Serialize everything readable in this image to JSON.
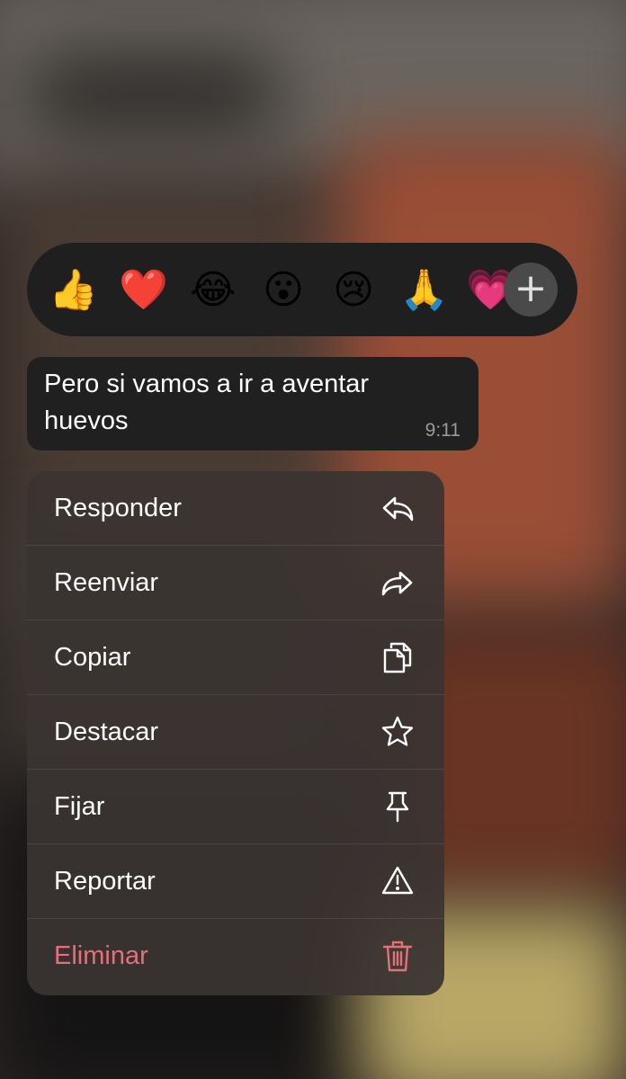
{
  "colors": {
    "menu_text": "#ffffff",
    "danger": "#e4707a",
    "bubble_bg": "#202020",
    "reaction_bar_bg": "#1f1f1f"
  },
  "reactions": [
    {
      "emoji": "👍",
      "name": "thumbs-up"
    },
    {
      "emoji": "❤️",
      "name": "red-heart"
    },
    {
      "emoji": "😂",
      "name": "tears-of-joy"
    },
    {
      "emoji": "😮",
      "name": "surprised"
    },
    {
      "emoji": "😢",
      "name": "crying"
    },
    {
      "emoji": "🙏",
      "name": "folded-hands"
    },
    {
      "emoji": "💗",
      "name": "pink-heart"
    }
  ],
  "more_reactions": {
    "icon": "plus-icon",
    "glyph": "+"
  },
  "message": {
    "text": "Pero si vamos a ir a aventar huevos",
    "time": "9:11"
  },
  "menu": {
    "items": [
      {
        "label": "Responder",
        "icon": "reply-icon"
      },
      {
        "label": "Reenviar",
        "icon": "forward-icon"
      },
      {
        "label": "Copiar",
        "icon": "copy-icon"
      },
      {
        "label": "Destacar",
        "icon": "star-icon"
      },
      {
        "label": "Fijar",
        "icon": "pin-icon"
      },
      {
        "label": "Reportar",
        "icon": "warning-icon"
      },
      {
        "label": "Eliminar",
        "icon": "trash-icon",
        "destructive": true
      }
    ]
  }
}
